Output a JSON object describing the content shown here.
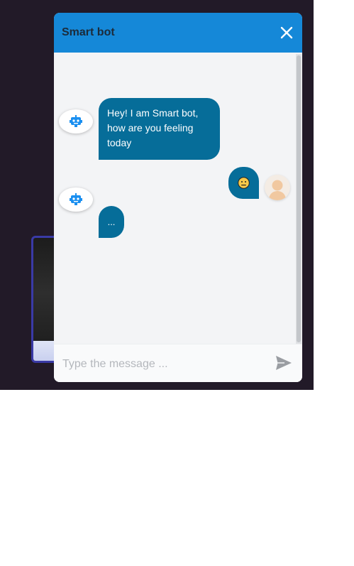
{
  "chat": {
    "title": "Smart bot",
    "input_placeholder": "Type the message ...",
    "messages": [
      {
        "sender": "bot",
        "text": "Hey! I am Smart bot, how are you feeling today"
      },
      {
        "sender": "user",
        "emoji": "neutral-face-emoji"
      },
      {
        "sender": "bot",
        "text": "..."
      }
    ]
  },
  "colors": {
    "header": "#1588d8",
    "bubble": "#066d99",
    "backdrop": "#221a28",
    "bot_icon": "#1a8ff0"
  },
  "icons": {
    "close": "close-icon",
    "send": "send-icon",
    "bot_avatar": "robot-icon",
    "user_avatar": "user-avatar"
  }
}
